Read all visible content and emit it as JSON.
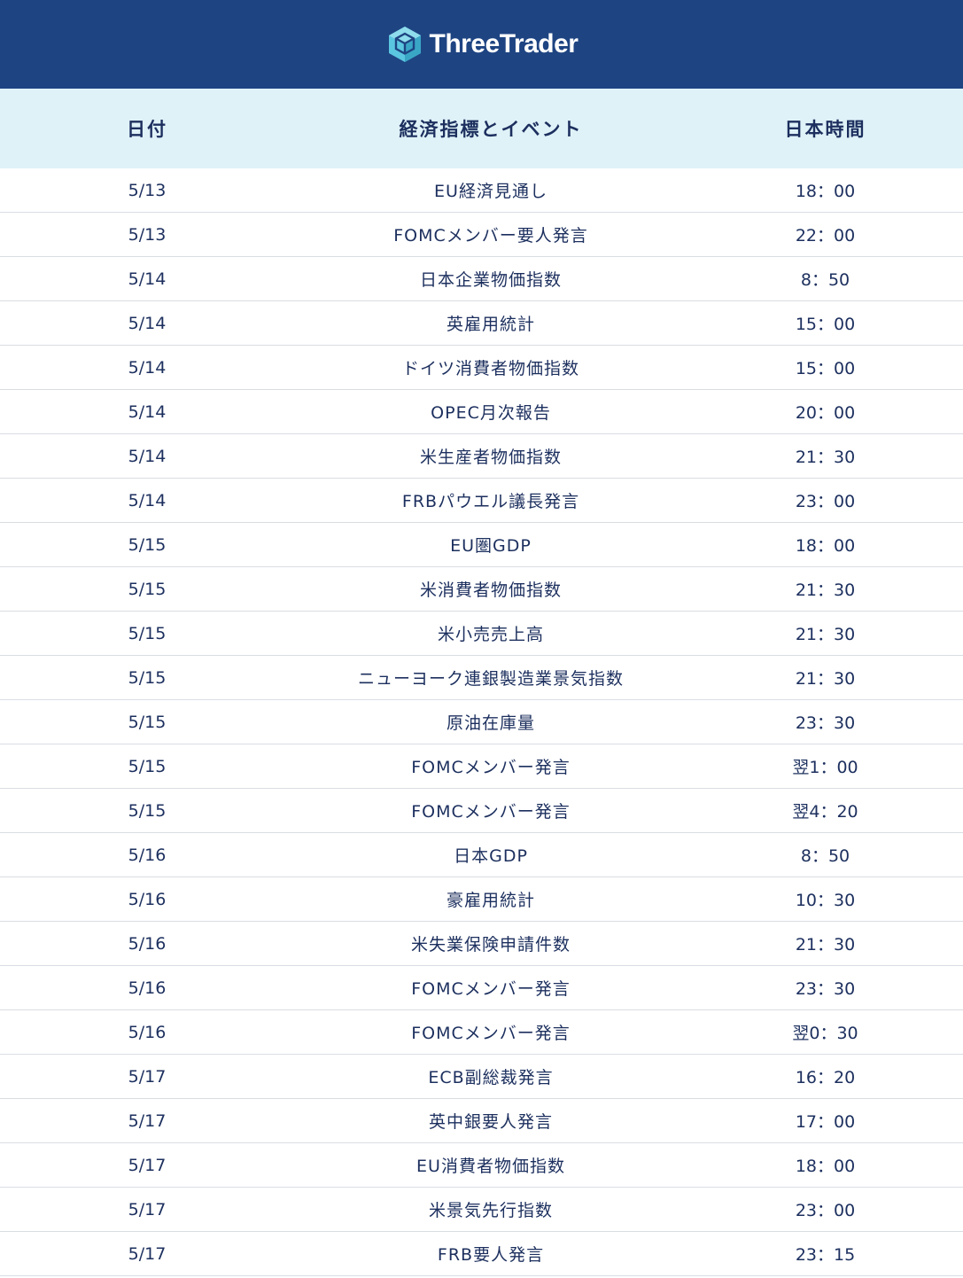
{
  "brand": {
    "name": "ThreeTrader",
    "bar_color": "#1e4482",
    "logo_color": "#5bc6e0"
  },
  "table": {
    "headers": {
      "date": "日付",
      "event": "経済指標とイベント",
      "time": "日本時間"
    },
    "header_background": "#dff2f8",
    "text_color": "#1c2f5e",
    "rows": [
      {
        "date": "5/13",
        "event": "EU経済見通し",
        "time": "18：00"
      },
      {
        "date": "5/13",
        "event": "FOMCメンバー要人発言",
        "time": "22：00"
      },
      {
        "date": "5/14",
        "event": "日本企業物価指数",
        "time": "8：50"
      },
      {
        "date": "5/14",
        "event": "英雇用統計",
        "time": "15：00"
      },
      {
        "date": "5/14",
        "event": "ドイツ消費者物価指数",
        "time": "15：00"
      },
      {
        "date": "5/14",
        "event": "OPEC月次報告",
        "time": "20：00"
      },
      {
        "date": "5/14",
        "event": "米生産者物価指数",
        "time": "21：30"
      },
      {
        "date": "5/14",
        "event": "FRBパウエル議長発言",
        "time": "23：00"
      },
      {
        "date": "5/15",
        "event": "EU圏GDP",
        "time": "18：00"
      },
      {
        "date": "5/15",
        "event": "米消費者物価指数",
        "time": "21：30"
      },
      {
        "date": "5/15",
        "event": "米小売売上高",
        "time": "21：30"
      },
      {
        "date": "5/15",
        "event": "ニューヨーク連銀製造業景気指数",
        "time": "21：30"
      },
      {
        "date": "5/15",
        "event": "原油在庫量",
        "time": "23：30"
      },
      {
        "date": "5/15",
        "event": "FOMCメンバー発言",
        "time": "翌1：00"
      },
      {
        "date": "5/15",
        "event": "FOMCメンバー発言",
        "time": "翌4：20"
      },
      {
        "date": "5/16",
        "event": "日本GDP",
        "time": "8：50"
      },
      {
        "date": "5/16",
        "event": "豪雇用統計",
        "time": "10：30"
      },
      {
        "date": "5/16",
        "event": "米失業保険申請件数",
        "time": "21：30"
      },
      {
        "date": "5/16",
        "event": "FOMCメンバー発言",
        "time": "23：30"
      },
      {
        "date": "5/16",
        "event": "FOMCメンバー発言",
        "time": "翌0：30"
      },
      {
        "date": "5/17",
        "event": "ECB副総裁発言",
        "time": "16：20"
      },
      {
        "date": "5/17",
        "event": "英中銀要人発言",
        "time": "17：00"
      },
      {
        "date": "5/17",
        "event": "EU消費者物価指数",
        "time": "18：00"
      },
      {
        "date": "5/17",
        "event": "米景気先行指数",
        "time": "23：00"
      },
      {
        "date": "5/17",
        "event": "FRB要人発言",
        "time": "23：15"
      }
    ]
  }
}
